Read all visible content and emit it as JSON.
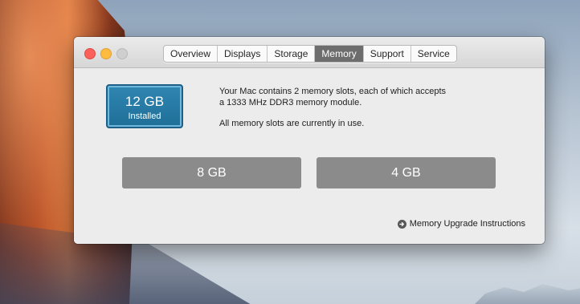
{
  "tabs": [
    {
      "label": "Overview",
      "active": false
    },
    {
      "label": "Displays",
      "active": false
    },
    {
      "label": "Storage",
      "active": false
    },
    {
      "label": "Memory",
      "active": true
    },
    {
      "label": "Support",
      "active": false
    },
    {
      "label": "Service",
      "active": false
    }
  ],
  "memory": {
    "installed_size": "12 GB",
    "installed_label": "Installed",
    "description_line1": "Your Mac contains 2 memory slots, each of which accepts",
    "description_line2": "a 1333 MHz DDR3 memory module.",
    "status_text": "All memory slots are currently in use.",
    "slots": [
      {
        "label": "8 GB"
      },
      {
        "label": "4 GB"
      }
    ],
    "upgrade_link": "Memory Upgrade Instructions"
  },
  "colors": {
    "badge": "#2f86b2",
    "slot": "#8b8b8b",
    "active_tab": "#6d6d6d",
    "close": "#fc605b",
    "minimize": "#fdbc40",
    "zoom_disabled": "#cfcfcf"
  },
  "icons": {
    "upgrade_link_icon": "arrow-circle-right-icon"
  }
}
